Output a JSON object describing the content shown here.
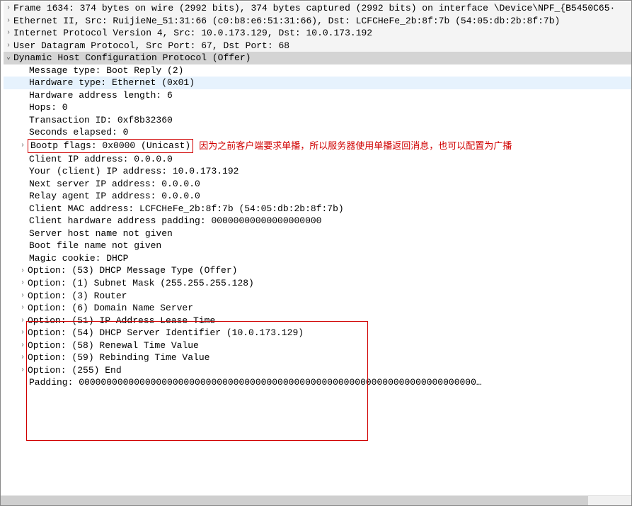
{
  "frame": "Frame 1634: 374 bytes on wire (2992 bits), 374 bytes captured (2992 bits) on interface \\Device\\NPF_{B5450C65·",
  "eth": "Ethernet II, Src: RuijieNe_51:31:66 (c0:b8:e6:51:31:66), Dst: LCFCHeFe_2b:8f:7b (54:05:db:2b:8f:7b)",
  "ip": "Internet Protocol Version 4, Src: 10.0.173.129, Dst: 10.0.173.192",
  "udp": "User Datagram Protocol, Src Port: 67, Dst Port: 68",
  "dhcp_header": "Dynamic Host Configuration Protocol (Offer)",
  "dhcp": {
    "msgtype": "Message type: Boot Reply (2)",
    "hwtype": "Hardware type: Ethernet (0x01)",
    "hwlen": "Hardware address length: 6",
    "hops": "Hops: 0",
    "xid": "Transaction ID: 0xf8b32360",
    "secs": "Seconds elapsed: 0",
    "flags": "Bootp flags: 0x0000 (Unicast)",
    "flags_annot": "因为之前客户端要求单播，所以服务器使用单播返回消息，也可以配置为广播",
    "ciaddr": "Client IP address: 0.0.0.0",
    "yiaddr": "Your (client) IP address: 10.0.173.192",
    "siaddr": "Next server IP address: 0.0.0.0",
    "giaddr": "Relay agent IP address: 0.0.0.0",
    "chaddr": "Client MAC address: LCFCHeFe_2b:8f:7b (54:05:db:2b:8f:7b)",
    "chpad": "Client hardware address padding: 00000000000000000000",
    "sname": "Server host name not given",
    "file": "Boot file name not given",
    "cookie": "Magic cookie: DHCP",
    "opt53": "Option: (53) DHCP Message Type (Offer)",
    "opt1": "Option: (1) Subnet Mask (255.255.255.128)",
    "opt3": "Option: (3) Router",
    "opt6": "Option: (6) Domain Name Server",
    "opt51": "Option: (51) IP Address Lease Time",
    "opt54": "Option: (54) DHCP Server Identifier (10.0.173.129)",
    "opt58": "Option: (58) Renewal Time Value",
    "opt59": "Option: (59) Rebinding Time Value",
    "opt255": "Option: (255) End",
    "padding": "Padding: 000000000000000000000000000000000000000000000000000000000000000000000000…"
  }
}
